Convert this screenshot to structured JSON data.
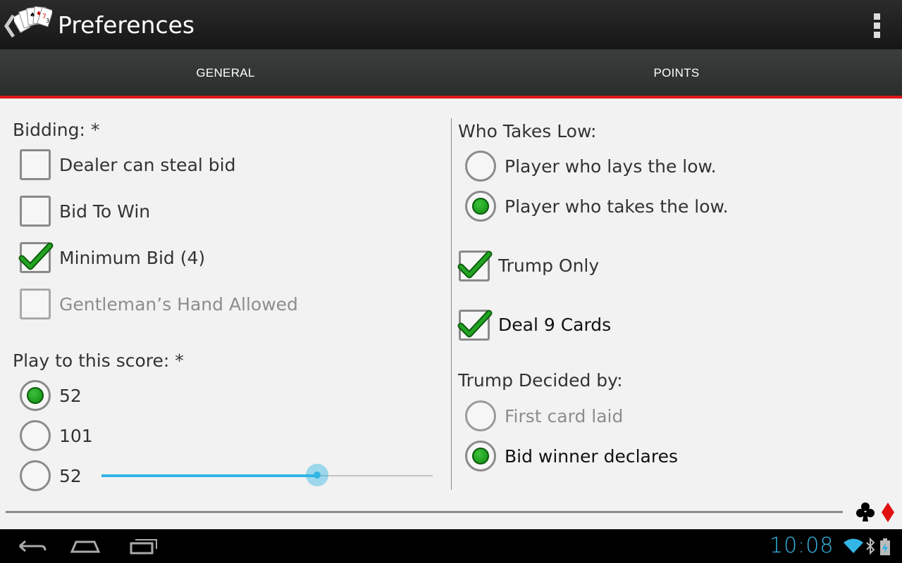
{
  "header": {
    "title": "Preferences"
  },
  "tabs": [
    {
      "label": "GENERAL"
    },
    {
      "label": "POINTS"
    }
  ],
  "left": {
    "bidding_label": "Bidding: *",
    "bidding_options": [
      {
        "label": "Dealer can steal bid",
        "checked": false,
        "enabled": true
      },
      {
        "label": "Bid To Win",
        "checked": false,
        "enabled": true
      },
      {
        "label": "Minimum Bid (4)",
        "checked": true,
        "enabled": true
      },
      {
        "label": "Gentleman’s Hand Allowed",
        "checked": false,
        "enabled": false
      }
    ],
    "score_label": "Play to this score: *",
    "score_options": [
      {
        "label": "52",
        "selected": true
      },
      {
        "label": "101",
        "selected": false
      },
      {
        "label": "52",
        "selected": false
      }
    ],
    "slider_fraction": 0.65
  },
  "right": {
    "low_label": "Who Takes Low:",
    "low_options": [
      {
        "label": "Player who lays the low.",
        "selected": false
      },
      {
        "label": "Player who takes the low.",
        "selected": true
      }
    ],
    "trump_only": {
      "label": "Trump Only",
      "checked": true
    },
    "deal_nine": {
      "label": "Deal 9 Cards",
      "checked": true
    },
    "trump_label": "Trump Decided by:",
    "trump_options": [
      {
        "label": "First card laid",
        "selected": false,
        "enabled": false
      },
      {
        "label": "Bid winner declares",
        "selected": true,
        "enabled": true
      }
    ]
  },
  "status": {
    "time": "10:08"
  },
  "colors": {
    "accent": "#33b5e5",
    "tab_indicator": "#e01818",
    "check_green": "#1a9a1a"
  }
}
